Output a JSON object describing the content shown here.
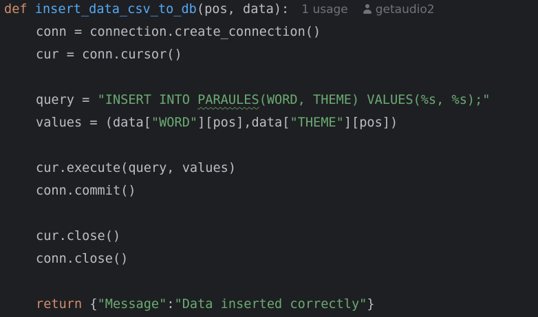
{
  "code": {
    "def_keyword": "def",
    "function_name": "insert_data_csv_to_db",
    "signature_params": "(pos, data):",
    "usage_hint": "1 usage",
    "author_hint": "getaudio2",
    "line2": "conn = connection.create_connection()",
    "line3": "cur = conn.cursor()",
    "line5_prefix": "query = ",
    "line5_str_a": "\"INSERT INTO ",
    "line5_str_typo": "PARAULES",
    "line5_str_b": "(WORD, THEME) VALUES(%s, %s);\"",
    "line6_a": "values = (data[",
    "line6_str_word": "\"WORD\"",
    "line6_b": "][pos],data[",
    "line6_str_theme": "\"THEME\"",
    "line6_c": "][pos])",
    "line8": "cur.execute(query, values)",
    "line9": "conn.commit()",
    "line11": "cur.close()",
    "line12": "conn.close()",
    "return_keyword": "return",
    "return_open": " {",
    "return_key": "\"Message\"",
    "return_colon": ":",
    "return_value": "\"Data inserted correctly\"",
    "return_close": "}"
  },
  "colors": {
    "background": "#1e1f22",
    "default_text": "#bcbec4",
    "keyword": "#cf8e6d",
    "function_name": "#56a8f5",
    "string": "#6aab73",
    "inlay_hint": "#6f737a"
  },
  "icons": {
    "author": "person-icon"
  }
}
